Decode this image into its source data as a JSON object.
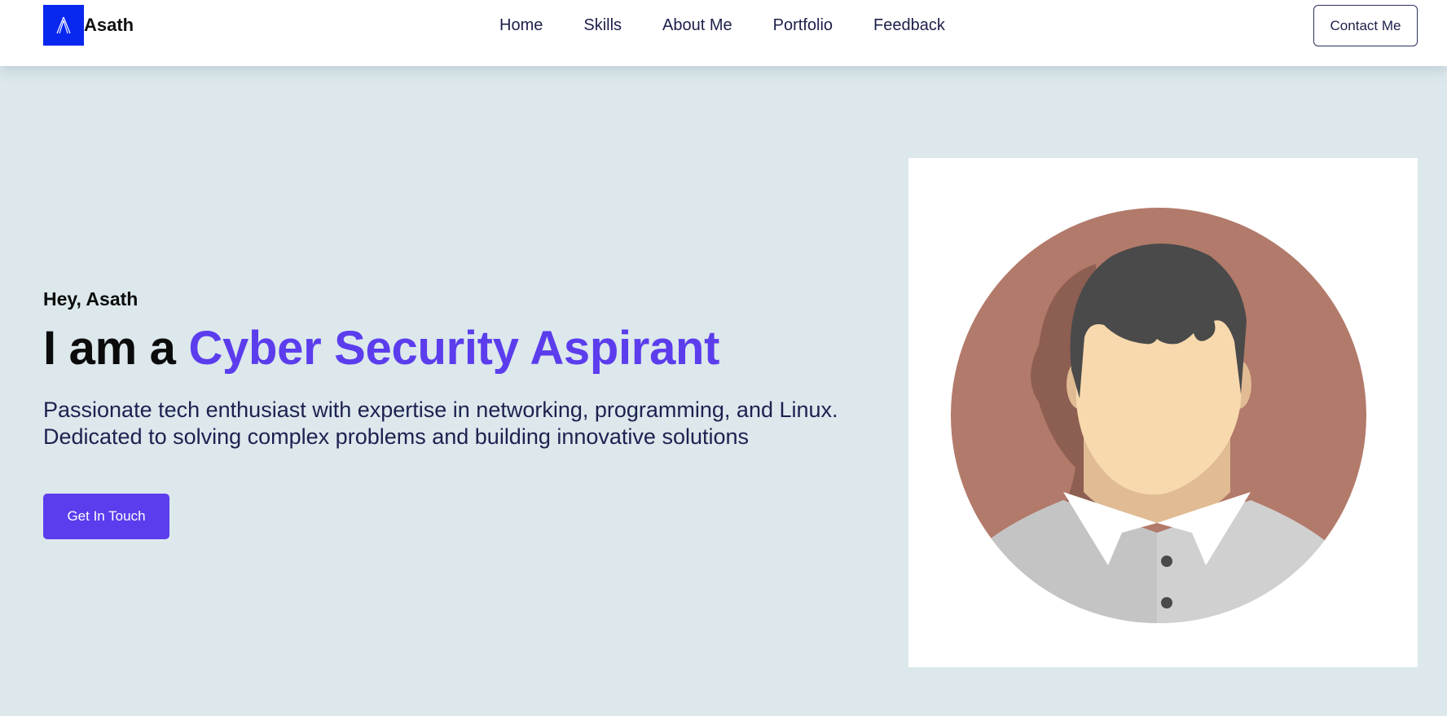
{
  "nav": {
    "brand": {
      "name": "Asath",
      "logo_icon": "a-letter-logo-icon",
      "logo_color": "#0a27f0"
    },
    "links": [
      {
        "label": "Home"
      },
      {
        "label": "Skills"
      },
      {
        "label": "About Me"
      },
      {
        "label": "Portfolio"
      },
      {
        "label": "Feedback"
      }
    ],
    "contact_button": "Contact Me"
  },
  "hero": {
    "greeting": "Hey, Asath",
    "headline_prefix": "I am a ",
    "headline_accent": "Cyber Security Aspirant",
    "description_line1": "Passionate tech enthusiast with expertise in networking, programming, and Linux.",
    "description_line2": "Dedicated to solving complex problems and building innovative solutions",
    "cta_button": "Get In Touch",
    "avatar_icon": "user-avatar-illustration"
  },
  "colors": {
    "accent": "#5b3ded",
    "background": "#dce8ec",
    "nav_text": "#1c1f4a",
    "avatar_bg": "#b27a6a",
    "hair": "#4a4a4a",
    "skin": "#f8d9ae",
    "shirt": "#d0d0d0"
  }
}
